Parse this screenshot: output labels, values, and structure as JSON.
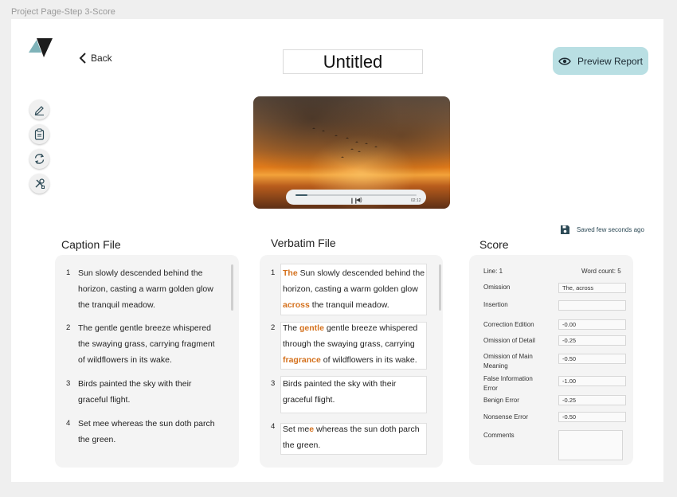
{
  "frame_label": "Project Page-Step 3-Score",
  "header": {
    "back_label": "Back",
    "title": "Untitled",
    "preview_label": "Preview Report"
  },
  "toolbar": {
    "icons": [
      "pen-icon",
      "clipboard-icon",
      "refresh-icon",
      "tools-icon"
    ]
  },
  "video": {
    "time": "02:12",
    "progress": 0.1
  },
  "saved_status": "Saved few seconds ago",
  "caption": {
    "title": "Caption File",
    "items": [
      {
        "num": "1",
        "lines": [
          "Sun slowly descended behind the",
          "horizon, casting a warm golden glow",
          "the tranquil meadow."
        ]
      },
      {
        "num": "2",
        "lines": [
          "The gentle gentle breeze whispered",
          "the swaying grass, carrying fragment",
          "of wildflowers in its wake."
        ]
      },
      {
        "num": "3",
        "lines": [
          "Birds painted the sky with their",
          "graceful flight."
        ]
      },
      {
        "num": "4",
        "lines": [
          "Set mee whereas the sun doth parch",
          "the green."
        ]
      }
    ]
  },
  "verbatim": {
    "title": "Verbatim File",
    "items": [
      {
        "num": "1",
        "l1_hl": "The",
        "l1_rest": " Sun slowly descended behind the",
        "l2": "horizon, casting a warm golden glow",
        "l3_hl": "across",
        "l3_rest": " the tranquil meadow."
      },
      {
        "num": "2",
        "l1_pre": "The ",
        "l1_hl": "gentle",
        "l1_rest": " gentle breeze whispered",
        "l2": "through the swaying grass, carrying",
        "l3_hl": "fragrance",
        "l3_rest": "  of wildflowers in its wake."
      },
      {
        "num": "3",
        "l1": "Birds painted the sky with their",
        "l2": "graceful flight."
      },
      {
        "num": "4",
        "l1_pre": "Set me",
        "l1_hl": "e",
        "l1_rest": " whereas the sun doth parch",
        "l2": "the green."
      }
    ]
  },
  "score": {
    "title": "Score",
    "line": "Line: 1",
    "word_count": "Word count: 5",
    "fields": [
      {
        "label": "Omission",
        "value": "The, across"
      },
      {
        "label": "Insertion",
        "value": ""
      },
      {
        "label": "Correction Edition",
        "value": "-0.00"
      },
      {
        "label": "Omission of Detail",
        "value": "-0.25"
      },
      {
        "label": "Omission of Main Meaning",
        "value": "-0.50"
      },
      {
        "label": "False Information Error",
        "value": "-1.00"
      },
      {
        "label": "Benign Error",
        "value": "-0.25"
      },
      {
        "label": "Nonsense Error",
        "value": "-0.50"
      }
    ],
    "comments_label": "Comments",
    "comments_value": ""
  }
}
